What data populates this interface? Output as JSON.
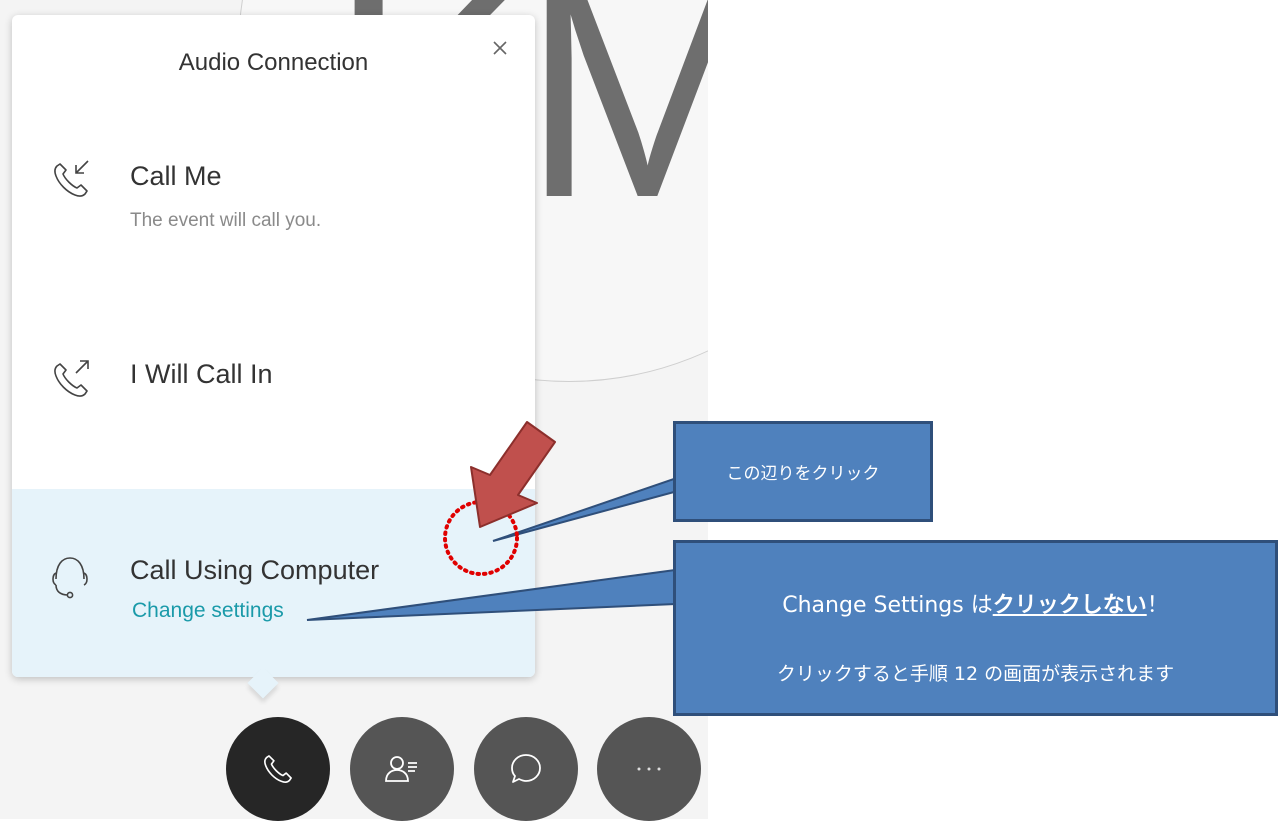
{
  "background": {
    "avatar_initials": "KM"
  },
  "dialog": {
    "title": "Audio Connection",
    "close_icon": "close-icon",
    "options": [
      {
        "icon": "phone-incoming-icon",
        "label": "Call Me",
        "sublabel": "The event will call you."
      },
      {
        "icon": "phone-outgoing-icon",
        "label": "I Will Call In"
      },
      {
        "icon": "headset-icon",
        "label": "Call Using Computer",
        "link": "Change settings",
        "highlighted": true
      }
    ]
  },
  "toolbar": {
    "buttons": [
      {
        "icon": "phone-icon",
        "active": true
      },
      {
        "icon": "participants-icon"
      },
      {
        "icon": "chat-icon"
      },
      {
        "icon": "more-icon"
      }
    ]
  },
  "annotations": {
    "callout1_text": "この辺りをクリック",
    "callout2_line1_prefix": "Change Settings は",
    "callout2_line1_emphasis": "クリックしない",
    "callout2_line1_suffix": "！",
    "callout2_line2": "クリックすると手順 12 の画面が表示されます",
    "colors": {
      "callout_fill": "#4f81bd",
      "callout_border": "#2f4f7a",
      "arrow_fill": "#c0504d",
      "marker_dots": "#e00000"
    }
  }
}
